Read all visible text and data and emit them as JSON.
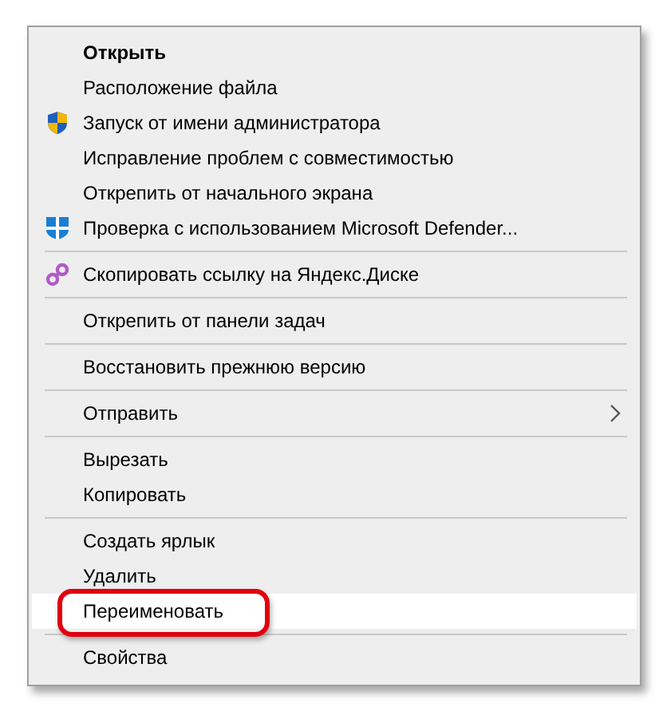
{
  "menu": {
    "items": [
      {
        "kind": "plain",
        "label": "Открыть",
        "default": true,
        "selected": false,
        "circled": false
      },
      {
        "kind": "plain",
        "label": "Расположение файла",
        "default": false,
        "selected": false,
        "circled": false
      },
      {
        "kind": "uac",
        "label": "Запуск от имени администратора",
        "default": false,
        "selected": false,
        "circled": false
      },
      {
        "kind": "plain",
        "label": "Исправление проблем с совместимостью",
        "default": false,
        "selected": false,
        "circled": false
      },
      {
        "kind": "plain",
        "label": "Открепить от начального экрана",
        "default": false,
        "selected": false,
        "circled": false
      },
      {
        "kind": "defender",
        "label": "Проверка с использованием Microsoft Defender...",
        "default": false,
        "selected": false,
        "circled": false
      },
      {
        "kind": "separator"
      },
      {
        "kind": "link",
        "label": "Скопировать ссылку на Яндекс.Диске",
        "default": false,
        "selected": false,
        "circled": false
      },
      {
        "kind": "separator"
      },
      {
        "kind": "plain",
        "label": "Открепить от панели задач",
        "default": false,
        "selected": false,
        "circled": false
      },
      {
        "kind": "separator"
      },
      {
        "kind": "plain",
        "label": "Восстановить прежнюю версию",
        "default": false,
        "selected": false,
        "circled": false
      },
      {
        "kind": "separator"
      },
      {
        "kind": "submenu",
        "label": "Отправить",
        "default": false,
        "selected": false,
        "circled": false
      },
      {
        "kind": "separator"
      },
      {
        "kind": "plain",
        "label": "Вырезать",
        "default": false,
        "selected": false,
        "circled": false
      },
      {
        "kind": "plain",
        "label": "Копировать",
        "default": false,
        "selected": false,
        "circled": false
      },
      {
        "kind": "separator"
      },
      {
        "kind": "plain",
        "label": "Создать ярлык",
        "default": false,
        "selected": false,
        "circled": false
      },
      {
        "kind": "plain",
        "label": "Удалить",
        "default": false,
        "selected": false,
        "circled": false
      },
      {
        "kind": "plain",
        "label": "Переименовать",
        "default": false,
        "selected": true,
        "circled": true
      },
      {
        "kind": "separator"
      },
      {
        "kind": "plain",
        "label": "Свойства",
        "default": false,
        "selected": false,
        "circled": false
      }
    ]
  }
}
